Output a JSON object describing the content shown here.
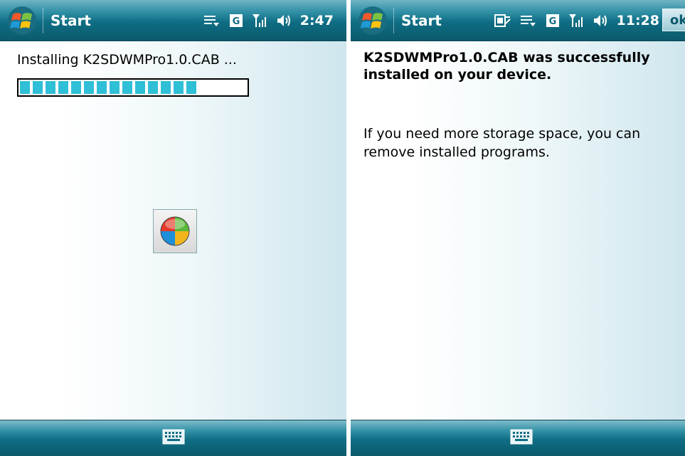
{
  "left_screen": {
    "titlebar": {
      "start_label": "Start",
      "clock": "2:47",
      "status_icons": [
        "menu-lines-icon",
        "g-network-icon",
        "signal-strength-icon",
        "volume-icon"
      ]
    },
    "install_label": "Installing K2SDWMPro1.0.CAB ...",
    "progress_fraction": 0.77,
    "spinner_icon": "windows-busy-icon",
    "bottom_icon": "keyboard-icon"
  },
  "right_screen": {
    "titlebar": {
      "start_label": "Start",
      "clock": "11:28",
      "ok_label": "ok",
      "status_icons": [
        "sim-card-icon",
        "menu-lines-icon",
        "g-network-icon",
        "signal-strength-icon",
        "volume-icon"
      ]
    },
    "headline": "K2SDWMPro1.0.CAB was successfully installed on your device.",
    "body": "If you need more storage space, you can remove installed programs.",
    "bottom_icon": "keyboard-icon"
  },
  "colors": {
    "titlebar": "#0f6d83",
    "progress": "#2fbfd6",
    "text": "#000000"
  }
}
